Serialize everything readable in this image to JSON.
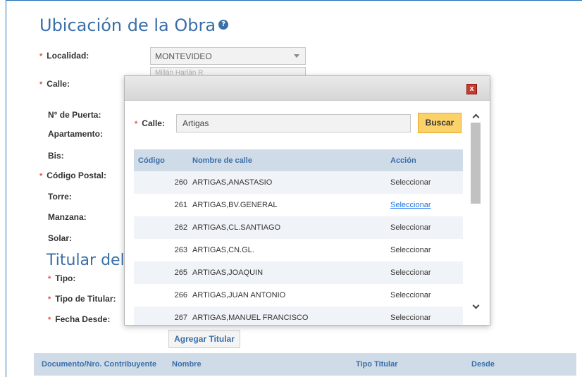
{
  "section": {
    "title": "Ubicación de la Obra",
    "fields": {
      "localidad_label": "Localidad:",
      "localidad_value": "MONTEVIDEO",
      "calle_label": "Calle:",
      "calle_placeholder": "Millán Harlán R",
      "puerta_label": "N° de Puerta:",
      "apartamento_label": "Apartamento:",
      "bis_label": "Bis:",
      "cp_label": "Código Postal:",
      "torre_label": "Torre:",
      "manzana_label": "Manzana:",
      "solar_label": "Solar:"
    }
  },
  "titular": {
    "title": "Titular del",
    "tipo_label": "Tipo:",
    "tipo_titular_label": "Tipo de Titular:",
    "fecha_label": "Fecha Desde:",
    "add_button": "Agregar Titular"
  },
  "bottom_table": {
    "headers": [
      "Documento/Nro. Contribuyente",
      "Nombre",
      "Tipo Titular",
      "Desde"
    ]
  },
  "modal": {
    "close_label": "x",
    "calle_label": "Calle:",
    "calle_value": "Artigas",
    "search_button": "Buscar",
    "headers": [
      "Código",
      "Nombre de calle",
      "Acción"
    ],
    "rows": [
      {
        "code": "260",
        "name": "ARTIGAS,ANASTASIO",
        "action": "Seleccionar"
      },
      {
        "code": "261",
        "name": "ARTIGAS,BV.GENERAL",
        "action": "Seleccionar"
      },
      {
        "code": "262",
        "name": "ARTIGAS,CL.SANTIAGO",
        "action": "Seleccionar"
      },
      {
        "code": "263",
        "name": "ARTIGAS,CN.GL.",
        "action": "Seleccionar"
      },
      {
        "code": "265",
        "name": "ARTIGAS,JOAQUIN",
        "action": "Seleccionar"
      },
      {
        "code": "266",
        "name": "ARTIGAS,JUAN ANTONIO",
        "action": "Seleccionar"
      },
      {
        "code": "267",
        "name": "ARTIGAS,MANUEL FRANCISCO",
        "action": "Seleccionar"
      }
    ]
  },
  "colors": {
    "accent": "#3a6fa8",
    "header_bg": "#d0dbe8",
    "search_button": "#fbd26a",
    "required": "#d9534f"
  }
}
